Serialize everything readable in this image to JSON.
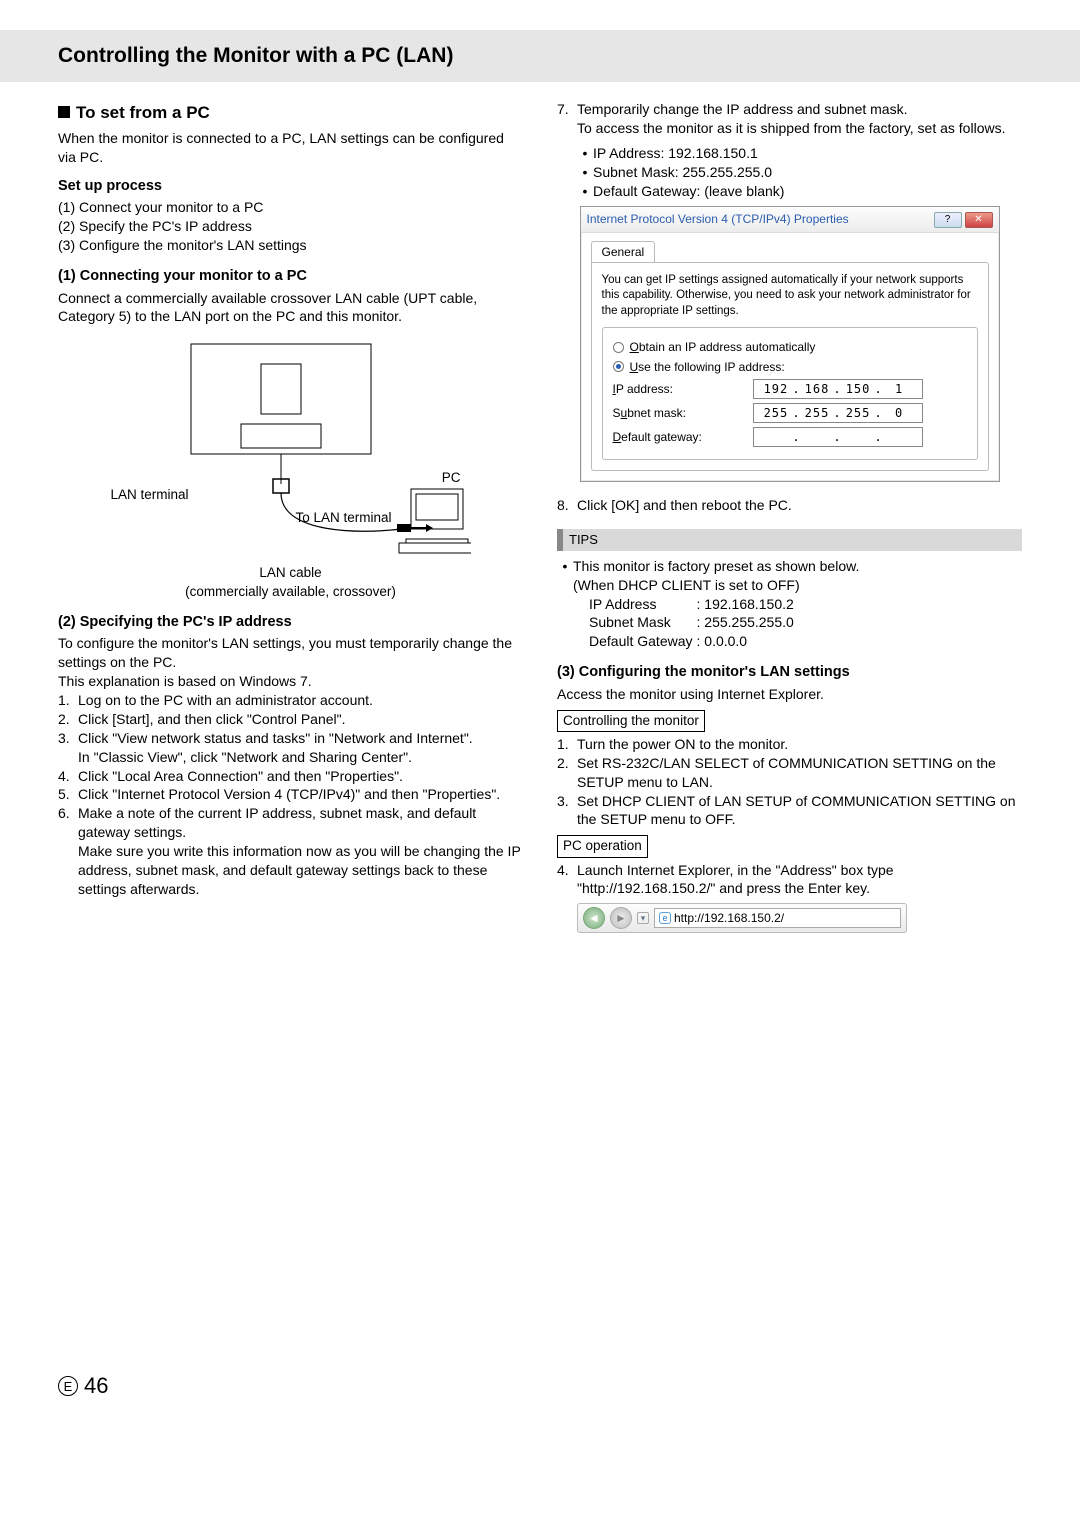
{
  "header": {
    "title": "Controlling the Monitor with a PC (LAN)"
  },
  "left": {
    "h_set_from_pc": "To set from a PC",
    "intro": "When the monitor is connected to a PC, LAN settings can be configured via PC.",
    "setup_head": "Set up process",
    "setup_steps": [
      "(1) Connect your monitor to a PC",
      "(2) Specify the PC's IP address",
      "(3) Configure the monitor's LAN settings"
    ],
    "conn_head": "(1) Connecting your monitor to a PC",
    "conn_body": "Connect a commercially available crossover LAN cable (UPT cable, Category 5) to the LAN  port on the PC and this monitor.",
    "fig": {
      "lan_terminal": "LAN terminal",
      "to_lan_terminal": "To LAN terminal",
      "pc": "PC",
      "lan_cable": "LAN cable",
      "cap": "(commercially available, crossover)"
    },
    "spec_head": "(2) Specifying the PC's IP address",
    "spec_intro1": "To configure the monitor's LAN settings, you must temporarily change the settings on the PC.",
    "spec_intro2": "This explanation is based on Windows 7.",
    "spec_steps": [
      {
        "n": "1.",
        "t": "Log on to the PC with an administrator account."
      },
      {
        "n": "2.",
        "t": "Click [Start], and then click \"Control Panel\"."
      },
      {
        "n": "3.",
        "t": "Click \"View network status and tasks\" in \"Network and Internet\".",
        "extra": "In \"Classic View\", click \"Network and Sharing Center\"."
      },
      {
        "n": "4.",
        "t": "Click \"Local Area Connection\" and then \"Properties\"."
      },
      {
        "n": "5.",
        "t": "Click \"Internet Protocol Version 4 (TCP/IPv4)\" and then \"Properties\"."
      },
      {
        "n": "6.",
        "t": "Make a note of the current IP address, subnet mask, and default gateway settings.",
        "extra": "Make sure you write this information now as you will be changing the IP address, subnet mask, and default gateway settings back to these settings afterwards."
      }
    ]
  },
  "right": {
    "step7_lead": "Temporarily change the IP address and subnet mask.",
    "step7_body": "To access the monitor as it is shipped from the factory, set as follows.",
    "step7_n": "7.",
    "step7_items": [
      "IP Address: 192.168.150.1",
      "Subnet Mask: 255.255.255.0",
      "Default Gateway: (leave blank)"
    ],
    "win": {
      "title": "Internet Protocol Version 4 (TCP/IPv4) Properties",
      "tab": "General",
      "desc": "You can get IP settings assigned automatically if your network supports this capability. Otherwise, you need to ask your network administrator for the appropriate IP settings.",
      "r_auto_pre": "O",
      "r_auto": "btain an IP address automatically",
      "r_use_pre": "U",
      "r_use": "se the following IP address:",
      "lbl_ip_pre": "I",
      "lbl_ip": "P address:",
      "lbl_sm_pre": "S",
      "lbl_sm_u": "u",
      "lbl_sm": "bnet mask:",
      "lbl_dg_pre": "D",
      "lbl_dg": "efault gateway:",
      "ip": [
        "192",
        "168",
        "150",
        "1"
      ],
      "sm": [
        "255",
        "255",
        "255",
        "0"
      ],
      "dg": [
        "",
        "",
        "",
        ""
      ]
    },
    "step8_n": "8.",
    "step8": "Click [OK] and then reboot the PC.",
    "tips_label": "TIPS",
    "tips_line1": "This monitor is factory preset as shown below.",
    "tips_line2": "(When DHCP CLIENT is set to OFF)",
    "tips_rows": [
      {
        "k": "IP Address",
        "v": ": 192.168.150.2"
      },
      {
        "k": "Subnet Mask",
        "v": ": 255.255.255.0"
      },
      {
        "k": "Default Gateway",
        "v": ": 0.0.0.0"
      }
    ],
    "cfg_head": "(3) Configuring the monitor's LAN settings",
    "cfg_sub": "Access the monitor using Internet Explorer.",
    "box_ctrl": "Controlling the monitor",
    "ctrl_steps": [
      {
        "n": "1.",
        "t": "Turn the power ON to the monitor."
      },
      {
        "n": "2.",
        "t": "Set RS-232C/LAN SELECT of COMMUNICATION SETTING on the SETUP menu to LAN."
      },
      {
        "n": "3.",
        "t": "Set DHCP CLIENT of LAN SETUP of COMMUNICATION SETTING on the SETUP menu to OFF."
      }
    ],
    "box_pc": "PC operation",
    "pc_step_n": "4.",
    "pc_step": "Launch Internet Explorer, in the \"Address\" box type \"http://192.168.150.2/\" and press the Enter key.",
    "ie_url": "http://192.168.150.2/"
  },
  "footer": {
    "e": "E",
    "page": "46"
  }
}
